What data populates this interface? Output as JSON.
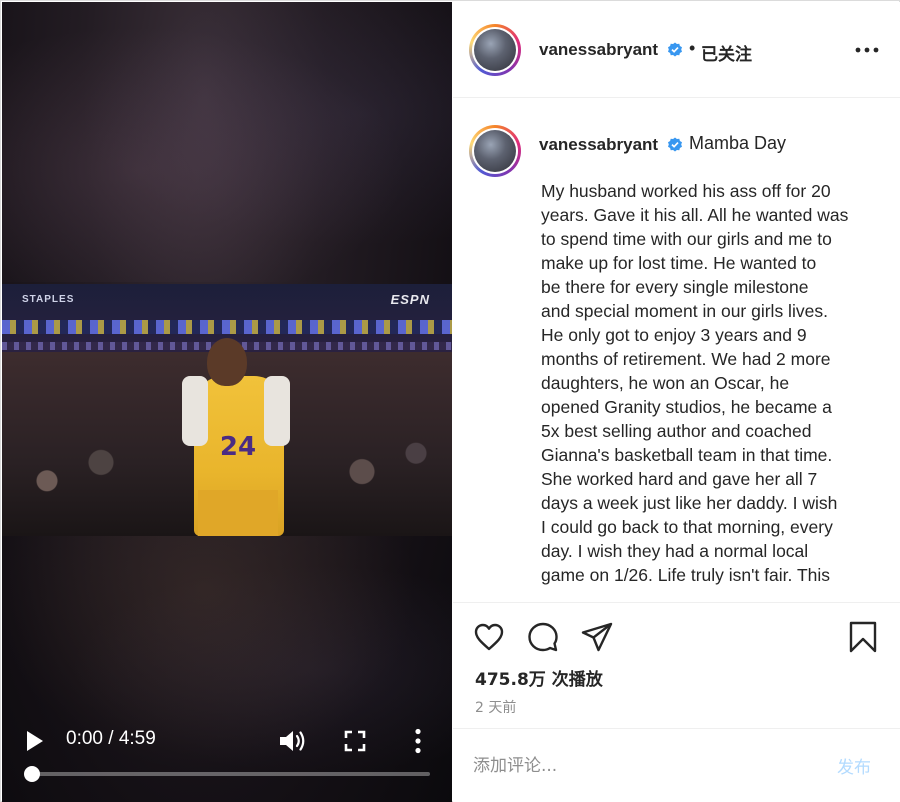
{
  "video": {
    "logo_top_left": "STAPLES",
    "logo_top_right": "ESPN",
    "jersey_number": "24",
    "time_display": "0:00 / 4:59",
    "progress_fraction": 0.0,
    "icons": [
      "play-icon",
      "volume-icon",
      "fullscreen-icon",
      "more-vertical-icon"
    ]
  },
  "header": {
    "username": "vanessabryant",
    "separator": "•",
    "follow_status": "已关注",
    "icons": [
      "avatar",
      "verified-badge-icon",
      "more-options-icon"
    ]
  },
  "caption": {
    "username": "vanessabryant",
    "title": "Mamba Day",
    "text": "My husband worked his ass off for 20\nyears. Gave it his all. All he wanted was\nto spend time with our girls and me to\nmake up for lost time. He wanted to\nbe there for every single milestone\nand special moment in our girls lives.\nHe only got to enjoy 3 years and 9\nmonths of retirement. We had 2 more\ndaughters, he won an Oscar, he\nopened Granity studios, he became a\n5x best selling author and coached\nGianna's basketball team in that time.\nShe worked hard and gave her all 7\ndays a week just like her daddy. I wish\nI could go back to that morning, every\nday. I wish they had a normal local\ngame on 1/26. Life truly isn't fair. This"
  },
  "actions": {
    "icons": [
      "heart-icon",
      "comment-icon",
      "share-icon",
      "bookmark-icon"
    ],
    "views": "475.8万 次播放",
    "posted": "2 天前"
  },
  "comment": {
    "placeholder": "添加评论...",
    "post_label": "发布"
  },
  "colors": {
    "verified_blue": "#3897f0",
    "post_button_disabled": "#b3dbff",
    "secondary_text": "#8e8e8e"
  }
}
